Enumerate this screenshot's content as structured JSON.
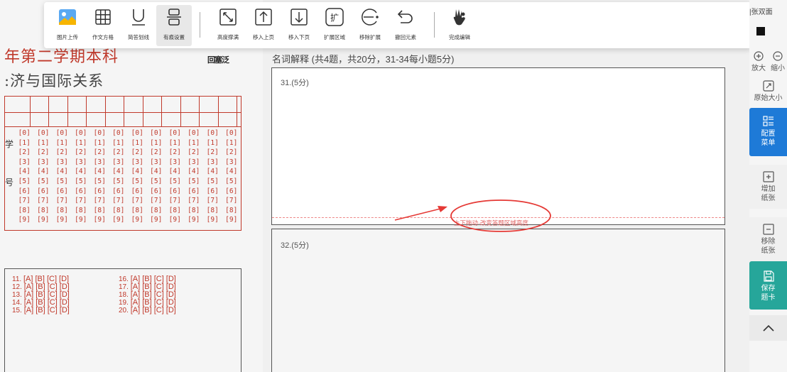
{
  "paper": {
    "title_line1": "年第二学期本科",
    "title_line2": ":济与国际关系",
    "qr_text": "回塞泛",
    "id_label_top": "学",
    "id_label_bottom": "号",
    "digit_rows": [
      "[0]",
      "[1]",
      "[2]",
      "[3]",
      "[4]",
      "[5]",
      "[6]",
      "[7]",
      "[8]",
      "[9]"
    ],
    "choices_left": [
      {
        "num": "11.",
        "opts": "[A] [B] [C] [D]"
      },
      {
        "num": "12.",
        "opts": "[A] [B] [C] [D]"
      },
      {
        "num": "13.",
        "opts": "[A] [B] [C] [D]"
      },
      {
        "num": "14.",
        "opts": "[A] [B] [C] [D]"
      },
      {
        "num": "15.",
        "opts": "[A] [B] [C] [D]"
      }
    ],
    "choices_right": [
      {
        "num": "16.",
        "opts": "[A] [B] [C] [D]"
      },
      {
        "num": "17.",
        "opts": "[A] [B] [C] [D]"
      },
      {
        "num": "18.",
        "opts": "[A] [B] [C] [D]"
      },
      {
        "num": "19.",
        "opts": "[A] [B] [C] [D]"
      },
      {
        "num": "20.",
        "opts": "[A] [B] [C] [D]"
      }
    ]
  },
  "section": {
    "title": "名词解释 (共4题，共20分，31-34每小题5分)",
    "q31_label": "31.(5分)",
    "q32_label": "32.(5分)",
    "drag_hint": "上下拖动·改变答题区域高度"
  },
  "toolbar": {
    "items": [
      {
        "label": "图片上传",
        "icon": "image-upload-icon"
      },
      {
        "label": "作文方格",
        "icon": "grid-icon"
      },
      {
        "label": "简答划线",
        "icon": "underline-icon"
      },
      {
        "label": "有痕设置",
        "icon": "layout-icon"
      },
      {
        "label": "高度撑满",
        "icon": "expand-diagonal-icon"
      },
      {
        "label": "移入上页",
        "icon": "arrow-up-box-icon"
      },
      {
        "label": "移入下页",
        "icon": "arrow-down-box-icon"
      },
      {
        "label": "扩展区域",
        "icon": "extend-icon"
      },
      {
        "label": "移除扩展",
        "icon": "remove-extend-icon"
      },
      {
        "label": "撤回元素",
        "icon": "undo-icon"
      },
      {
        "label": "完成编辑",
        "icon": "ok-hand-icon"
      }
    ]
  },
  "sidebar": {
    "top_text": "|张双面",
    "zoom_in": "放大",
    "zoom_out": "缩小",
    "original_size": "原始大小",
    "config_menu": "配置菜单",
    "add_sheet": "增加纸张",
    "remove_sheet": "移除纸张",
    "save_card": "保存题卡"
  },
  "colors": {
    "accent_blue": "#1e7ad7",
    "accent_teal": "#26a69a",
    "paper_red": "#c0392b"
  }
}
